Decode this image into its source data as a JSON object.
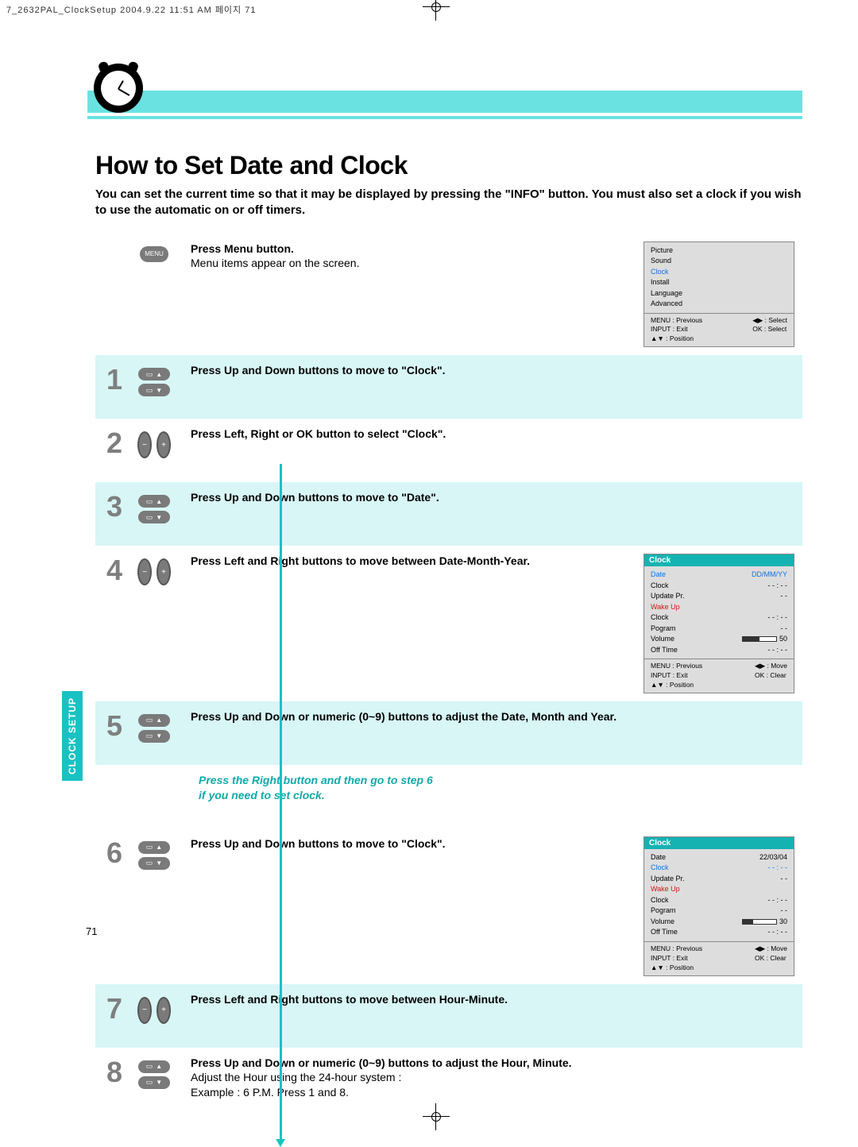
{
  "header_line": "7_2632PAL_ClockSetup  2004.9.22 11:51 AM  페이지 71",
  "title": "How to Set Date and Clock",
  "intro": "You can set the current time so that it may be displayed by pressing the \"INFO\" button. You must also set a clock if you wish to use the automatic on or off timers.",
  "side_tab": "CLOCK SETUP",
  "page_number": "71",
  "menu_label": "MENU",
  "step_menu": {
    "bold": "Press Menu button.",
    "plain": "Menu items appear on the screen."
  },
  "steps": [
    {
      "n": "1",
      "icon": "updown",
      "bold": "Press Up and Down buttons to move to \"Clock\"."
    },
    {
      "n": "2",
      "icon": "lr",
      "bold": "Press Left, Right or OK button to select \"Clock\"."
    },
    {
      "n": "3",
      "icon": "updown",
      "bold": "Press Up and Down buttons to move to \"Date\"."
    },
    {
      "n": "4",
      "icon": "lr",
      "bold": "Press Left and Right buttons to move between Date-Month-Year."
    },
    {
      "n": "5",
      "icon": "updown",
      "bold": "Press Up and Down or numeric (0~9) buttons to adjust the Date, Month and Year."
    }
  ],
  "mid_note_1": "Press the Right button and then go to step 6",
  "mid_note_2": "if you need to set clock.",
  "steps2": [
    {
      "n": "6",
      "icon": "updown",
      "bold": "Press Up and Down buttons to move to \"Clock\"."
    },
    {
      "n": "7",
      "icon": "lr",
      "bold": "Press Left and Right buttons to move between Hour-Minute."
    },
    {
      "n": "8",
      "icon": "updown",
      "bold": "Press Up and Down or numeric (0~9) buttons to adjust the Hour, Minute.",
      "plain1": "Adjust the Hour using the 24-hour system :",
      "plain2": "Example : 6 P.M. Press 1 and 8."
    }
  ],
  "osd1": {
    "items": [
      "Picture",
      "Sound",
      "Clock",
      "Install",
      "Language",
      "Advanced"
    ],
    "highlight_index": 2,
    "foot_left": [
      "MENU : Previous",
      "INPUT : Exit",
      "▲▼ : Position"
    ],
    "foot_right": [
      "◀▶ : Select",
      "OK : Select"
    ]
  },
  "osd2": {
    "title": "Clock",
    "rows": [
      {
        "l": "Date",
        "r": "DD/MM/YY",
        "hl": true
      },
      {
        "l": "Clock",
        "r": "- - : - -"
      },
      {
        "l": "Update Pr.",
        "r": "- -"
      },
      {
        "l": "Wake Up",
        "r": "",
        "red": true
      },
      {
        "l": "  Clock",
        "r": "- - : - -"
      },
      {
        "l": "  Pogram",
        "r": "- -"
      },
      {
        "l": "  Volume",
        "r": "50",
        "bar": 0.5
      },
      {
        "l": "Off Time",
        "r": "- - : - -"
      }
    ],
    "foot_left": [
      "MENU : Previous",
      "INPUT : Exit",
      "▲▼ : Position"
    ],
    "foot_right": [
      "◀▶ : Move",
      "OK : Clear"
    ]
  },
  "osd3": {
    "title": "Clock",
    "rows": [
      {
        "l": "Date",
        "r": "22/03/04"
      },
      {
        "l": "Clock",
        "r": "- - : - -",
        "hl": true
      },
      {
        "l": "Update Pr.",
        "r": "- -"
      },
      {
        "l": "Wake Up",
        "r": "",
        "red": true
      },
      {
        "l": "  Clock",
        "r": "- - : - -"
      },
      {
        "l": "  Pogram",
        "r": "- -"
      },
      {
        "l": "  Volume",
        "r": "30",
        "bar": 0.3
      },
      {
        "l": "Off Time",
        "r": "- - : - -"
      }
    ],
    "foot_left": [
      "MENU : Previous",
      "INPUT : Exit",
      "▲▼ : Position"
    ],
    "foot_right": [
      "◀▶ : Move",
      "OK : Clear"
    ]
  }
}
